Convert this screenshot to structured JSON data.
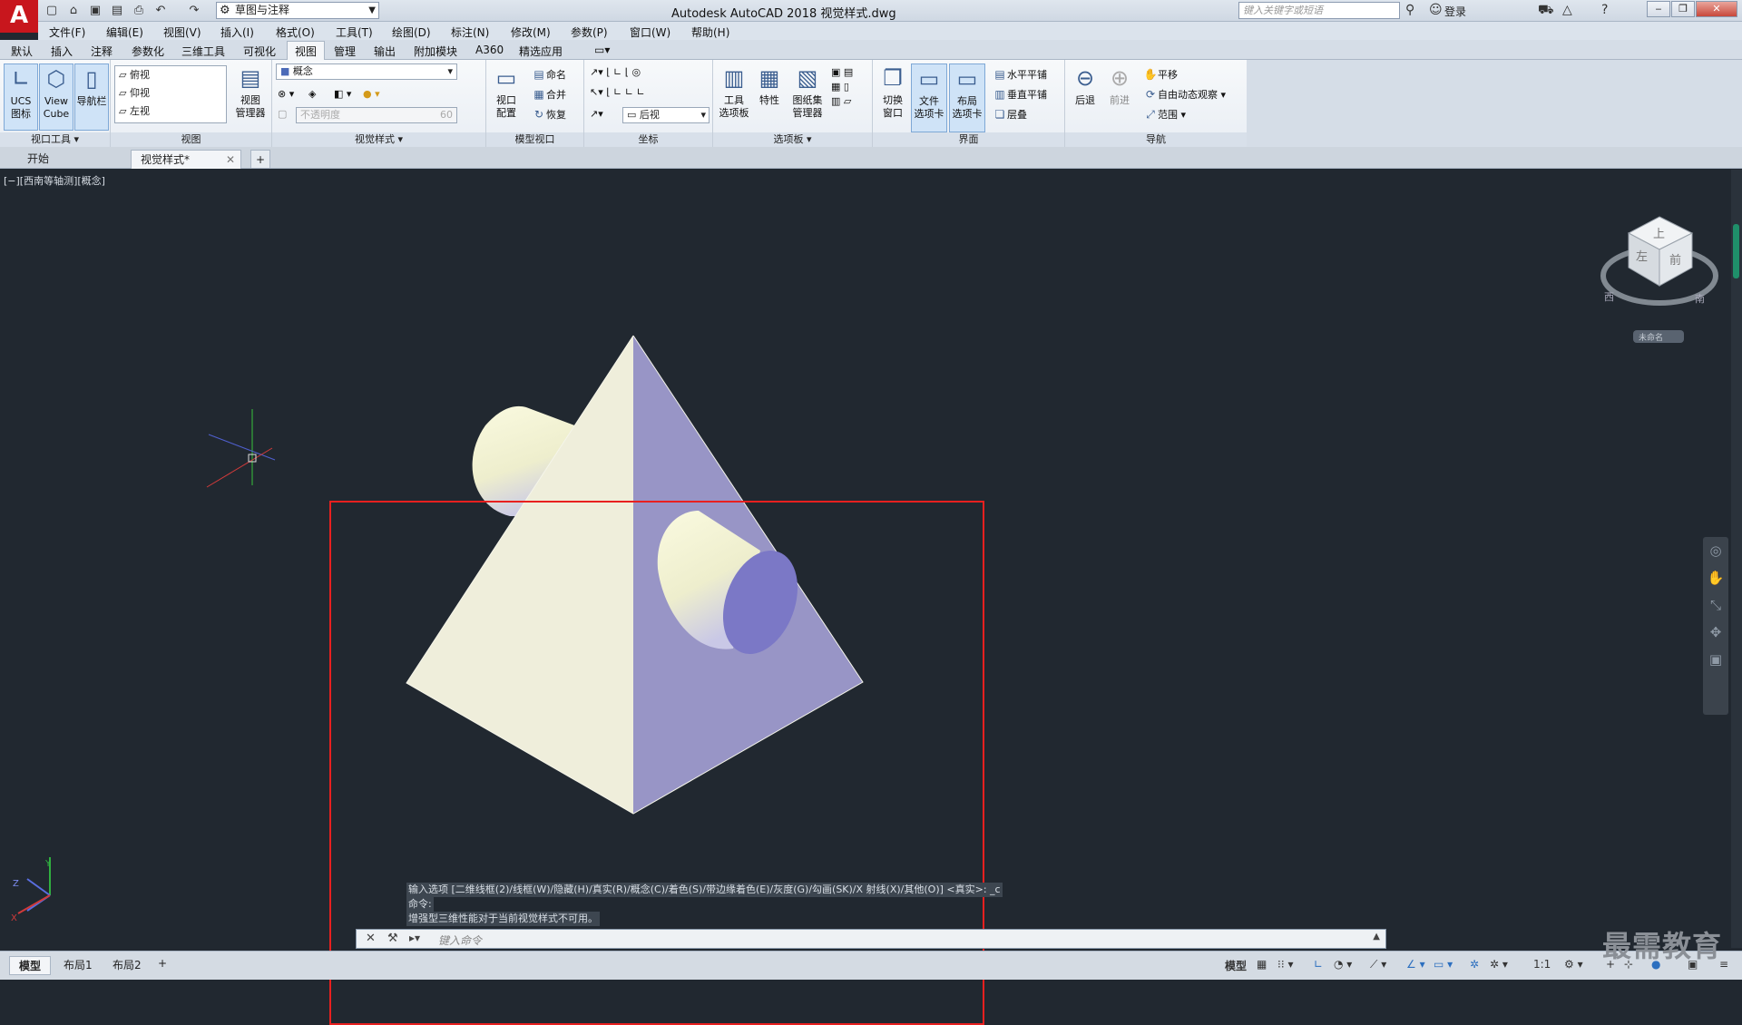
{
  "titlebar": {
    "app_logo": "A",
    "workspace": "草图与注释",
    "app_title": "Autodesk AutoCAD 2018    视觉样式.dwg",
    "search_placeholder": "键入关键字或短语",
    "login": "登录"
  },
  "menubar": {
    "items": [
      "文件(F)",
      "编辑(E)",
      "视图(V)",
      "插入(I)",
      "格式(O)",
      "工具(T)",
      "绘图(D)",
      "标注(N)",
      "修改(M)",
      "参数(P)",
      "窗口(W)",
      "帮助(H)"
    ]
  },
  "ribbon_tabs": {
    "items": [
      "默认",
      "插入",
      "注释",
      "参数化",
      "三维工具",
      "可视化",
      "视图",
      "管理",
      "输出",
      "附加模块",
      "A360",
      "精选应用"
    ],
    "active": "视图"
  },
  "ribbon": {
    "viewport_tools": {
      "ucs": "UCS\n图标",
      "viewcube": "View\nCube",
      "navbar": "导航栏",
      "title": "视口工具"
    },
    "views": {
      "items": [
        "俯视",
        "仰视",
        "左视"
      ],
      "manager": "视图\n管理器",
      "title": "视图"
    },
    "visual_styles": {
      "current": "概念",
      "opacity_label": "不透明度",
      "opacity_value": "60",
      "title": "视觉样式"
    },
    "model_viewports": {
      "config": "视口\n配置",
      "name": "命名",
      "merge": "合并",
      "restore": "恢复",
      "title": "模型视口"
    },
    "coordinates": {
      "view": "后视",
      "title": "坐标"
    },
    "palettes": {
      "tool": "工具\n选项板",
      "props": "特性",
      "sheetset": "图纸集\n管理器",
      "title": "选项板"
    },
    "interface": {
      "switch": "切换\n窗口",
      "filetab": "文件\n选项卡",
      "layouttab": "布局\n选项卡",
      "tile_h": "水平平铺",
      "tile_v": "垂直平铺",
      "cascade": "层叠",
      "title": "界面"
    },
    "navigate": {
      "back": "后退",
      "forward": "前进",
      "pan": "平移",
      "orbit": "自由动态观察",
      "extents": "范围",
      "title": "导航"
    }
  },
  "doc_tabs": {
    "start": "开始",
    "current": "视觉样式*"
  },
  "viewport": {
    "label": "[−][西南等轴测][概念]",
    "viewcube_top": "上",
    "viewcube_front": "前",
    "viewcube_left": "左",
    "compass_w": "西",
    "compass_s": "南",
    "ucs_name": "未命名",
    "colors": {
      "pyramid_left": "#efeedb",
      "pyramid_right": "#9895c6",
      "cylinder": "#f3f2cf",
      "cylinder_face": "#7b78c6",
      "selection": "#e8201f"
    }
  },
  "command": {
    "history": [
      "输入选项 [二维线框(2)/线框(W)/隐藏(H)/真实(R)/概念(C)/着色(S)/带边缘着色(E)/灰度(G)/勾画(SK)/X 射线(X)/其他(O)] <真实>: _c",
      "命令:",
      "增强型三维性能对于当前视觉样式不可用。"
    ],
    "placeholder": "键入命令"
  },
  "statusbar": {
    "tabs": [
      "模型",
      "布局1",
      "布局2"
    ],
    "model_label": "模型",
    "scale": "1:1"
  },
  "watermark": "最需教育"
}
